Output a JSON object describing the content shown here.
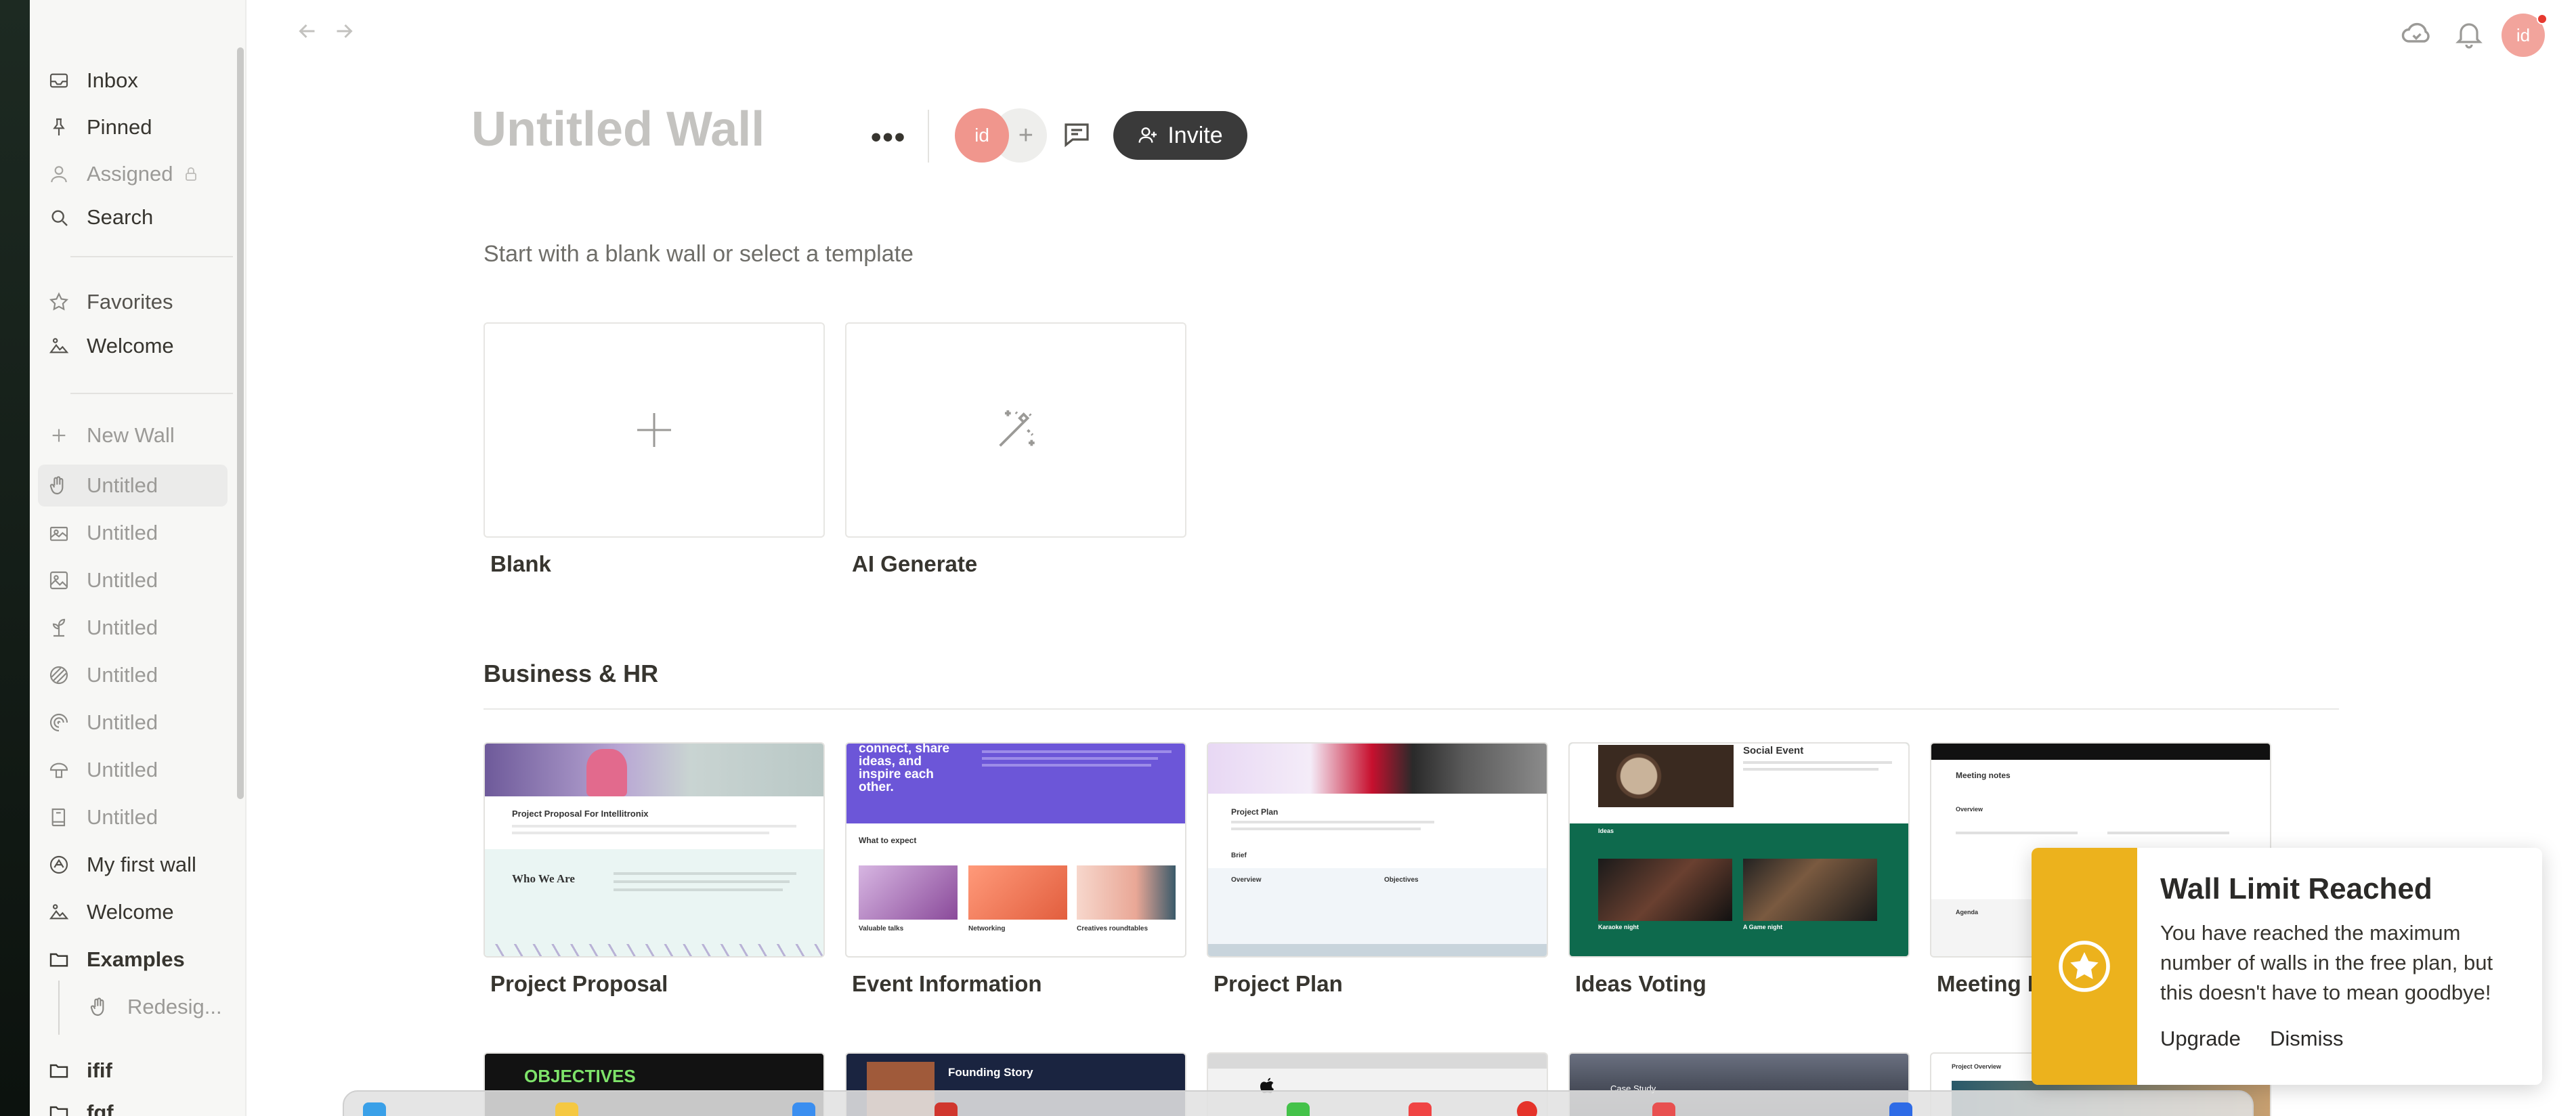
{
  "sidebar": {
    "items": [
      {
        "label": "Inbox",
        "icon": "inbox-icon"
      },
      {
        "label": "Pinned",
        "icon": "pin-icon"
      },
      {
        "label": "Assigned",
        "icon": "user-icon"
      },
      {
        "label": "Search",
        "icon": "search-icon"
      }
    ],
    "favorites_label": "Favorites",
    "favorites": [
      {
        "label": "Welcome"
      }
    ],
    "new_wall_label": "New Wall",
    "walls": [
      {
        "label": "Untitled"
      },
      {
        "label": "Untitled"
      },
      {
        "label": "Untitled"
      },
      {
        "label": "Untitled"
      },
      {
        "label": "Untitled"
      },
      {
        "label": "Untitled"
      },
      {
        "label": "Untitled"
      },
      {
        "label": "Untitled"
      },
      {
        "label": "My first wall"
      },
      {
        "label": "Welcome"
      }
    ],
    "examples_label": "Examples",
    "examples_child": "Redesig...",
    "folder1": "ifif",
    "folder2": "fgf"
  },
  "header": {
    "title_placeholder": "Untitled Wall",
    "more": "•••",
    "avatar_initials": "id",
    "add_member": "+",
    "invite_label": "Invite"
  },
  "topbar": {
    "avatar_initials": "id"
  },
  "start": {
    "subtitle": "Start with a blank wall or select a template",
    "blank_label": "Blank",
    "ai_label": "AI Generate"
  },
  "section": {
    "title": "Business & HR",
    "cards": [
      {
        "label": "Project Proposal"
      },
      {
        "label": "Event Information"
      },
      {
        "label": "Project Plan"
      },
      {
        "label": "Ideas Voting"
      },
      {
        "label": "Meeting I"
      }
    ]
  },
  "previews": {
    "proposal_heading": "Project Proposal For Intellitronix",
    "proposal_who": "Who We Are",
    "event_hero": "connect, share ideas, and inspire each other.",
    "event_expect": "What to expect",
    "event_cols": [
      "Valuable talks",
      "Networking",
      "Creatives roundtables"
    ],
    "plan_title": "Project Plan",
    "plan_brief": "Brief",
    "plan_overview": "Overview",
    "plan_objectives": "Objectives",
    "voting_title": "Social Event",
    "voting_ideas": "Ideas",
    "voting_a": "Karaoke night",
    "voting_b": "A Game night",
    "meeting_title": "Meeting notes",
    "meeting_overview": "Overview",
    "meeting_agenda": "Agenda",
    "row2_objectives": "OBJECTIVES",
    "row2_founding": "Founding Story",
    "row2_case": "Case Study",
    "row2_overview": "Project Overview"
  },
  "toast": {
    "title": "Wall Limit Reached",
    "message": "You have reached the maximum number of walls in the free plan, but this doesn't have to mean goodbye!",
    "upgrade": "Upgrade",
    "dismiss": "Dismiss"
  },
  "colors": {
    "accent_dark": "#3a3a3a",
    "avatar": "#f0968d",
    "toast_band": "#ecb21d",
    "event_purple": "#6c56d8",
    "voting_green": "#0e6a4d"
  }
}
